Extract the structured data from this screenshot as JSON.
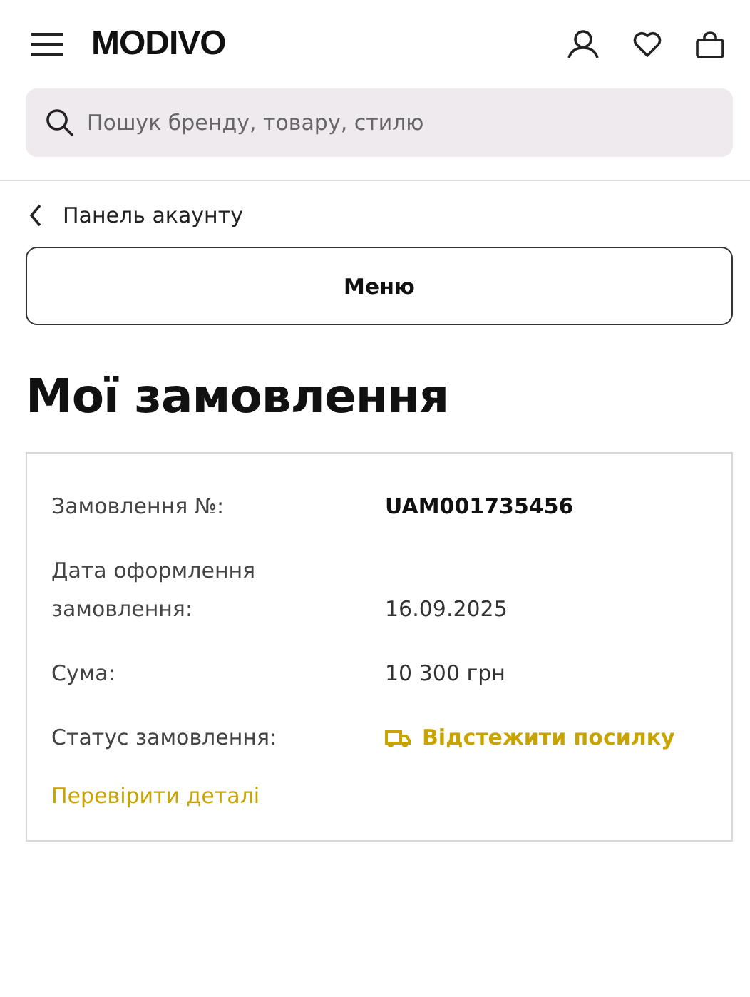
{
  "header": {
    "logo": "MODIVO"
  },
  "search": {
    "placeholder": "Пошук бренду, товару, стилю"
  },
  "breadcrumb": {
    "label": "Панель акаунту"
  },
  "menu_button": {
    "label": "Меню"
  },
  "page_title": "Мої замовлення",
  "order": {
    "rows": [
      {
        "label": "Замовлення №:",
        "value": "UAM001735456",
        "kind": "strong"
      },
      {
        "label": "Дата оформлення замовлення:",
        "value": "16.09.2025",
        "kind": "text"
      },
      {
        "label": "Сума:",
        "value": "10 300 грн",
        "kind": "text"
      },
      {
        "label": "Статус замовлення:",
        "value": "Відстежити посилку",
        "kind": "track"
      }
    ],
    "details_link": "Перевірити деталі"
  }
}
